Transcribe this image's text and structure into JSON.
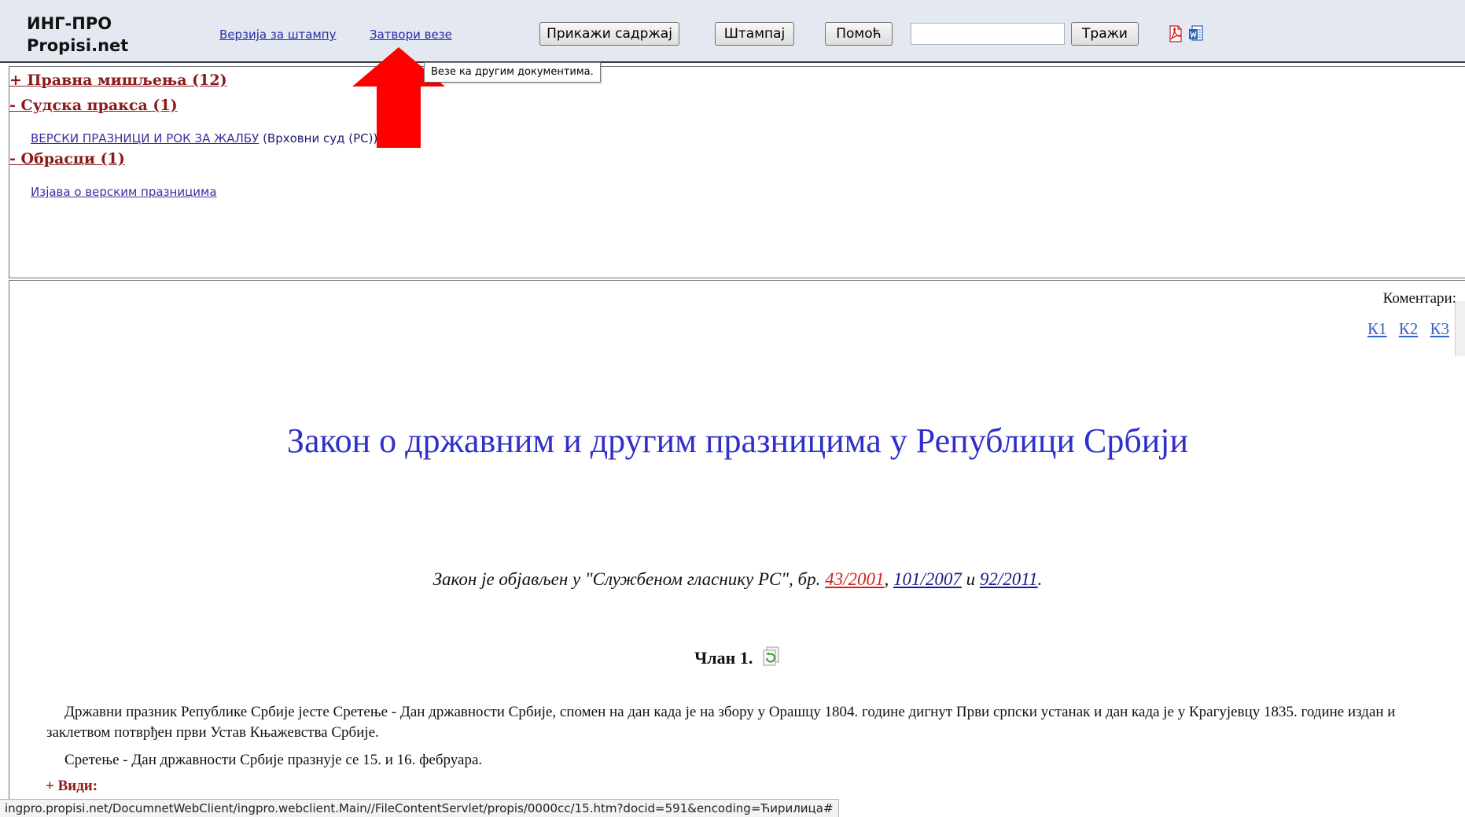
{
  "toolbar": {
    "brand_line1": "ИНГ-ПРО",
    "brand_line2": "Propisi.net",
    "print_version_link": "Верзија за штампу",
    "close_links_link": "Затвори везе",
    "show_contents_button": "Прикажи садржај",
    "print_button": "Штампај",
    "help_button": "Помоћ",
    "search_value": "",
    "search_button": "Тражи",
    "icons": [
      "pdf-icon",
      "word-icon"
    ]
  },
  "tooltip": {
    "text": "Везе ка другим документима."
  },
  "annotation": {
    "color": "#ff0000"
  },
  "links_panel": {
    "sections": [
      {
        "heading": "+ Правна мишљења (12)"
      },
      {
        "heading": "- Судска пракса (1)",
        "items": [
          {
            "label": "ВЕРСКИ ПРАЗНИЦИ И РОК ЗА ЖАЛБУ",
            "note": "(Врховни суд (РС))"
          }
        ]
      },
      {
        "heading": "- Обрасци (1)",
        "items": [
          {
            "label": "Изјава о верским празницима"
          }
        ]
      }
    ]
  },
  "document": {
    "comments_label": "Коментари:",
    "comment_links": [
      "К1",
      "К2",
      "К3"
    ],
    "title": "Закон о државним и другим празницима у Републици Србији",
    "gazette_prefix": "Закон је објављен у \"Службеном гласнику РС\", бр. ",
    "gazette_links": [
      "43/2001",
      "101/2007",
      "92/2011"
    ],
    "gazette_sep1": ", ",
    "gazette_sep2": " и ",
    "gazette_end": ".",
    "article_heading": "Члан 1.",
    "paragraphs": [
      "Државни празник Републике Србије јесте Сретење - Дан државности Србије, спомен на дан када је на збору у Орашцу 1804. године дигнут Први српски устанак и дан када је у Крагујевцу 1835. године издан и заклетвом потврђен први Устав Књажевства Србије.",
      "Сретење - Дан државности Србије празнује се 15. и 16. фебруара."
    ],
    "see_also": "+ Види:"
  },
  "status_bar": {
    "url": "ingpro.propisi.net/DocumnetWebClient/ingpro.webclient.Main//FileContentServlet/propis/0000cc/15.htm?docid=591&encoding=Ћирилица#"
  }
}
